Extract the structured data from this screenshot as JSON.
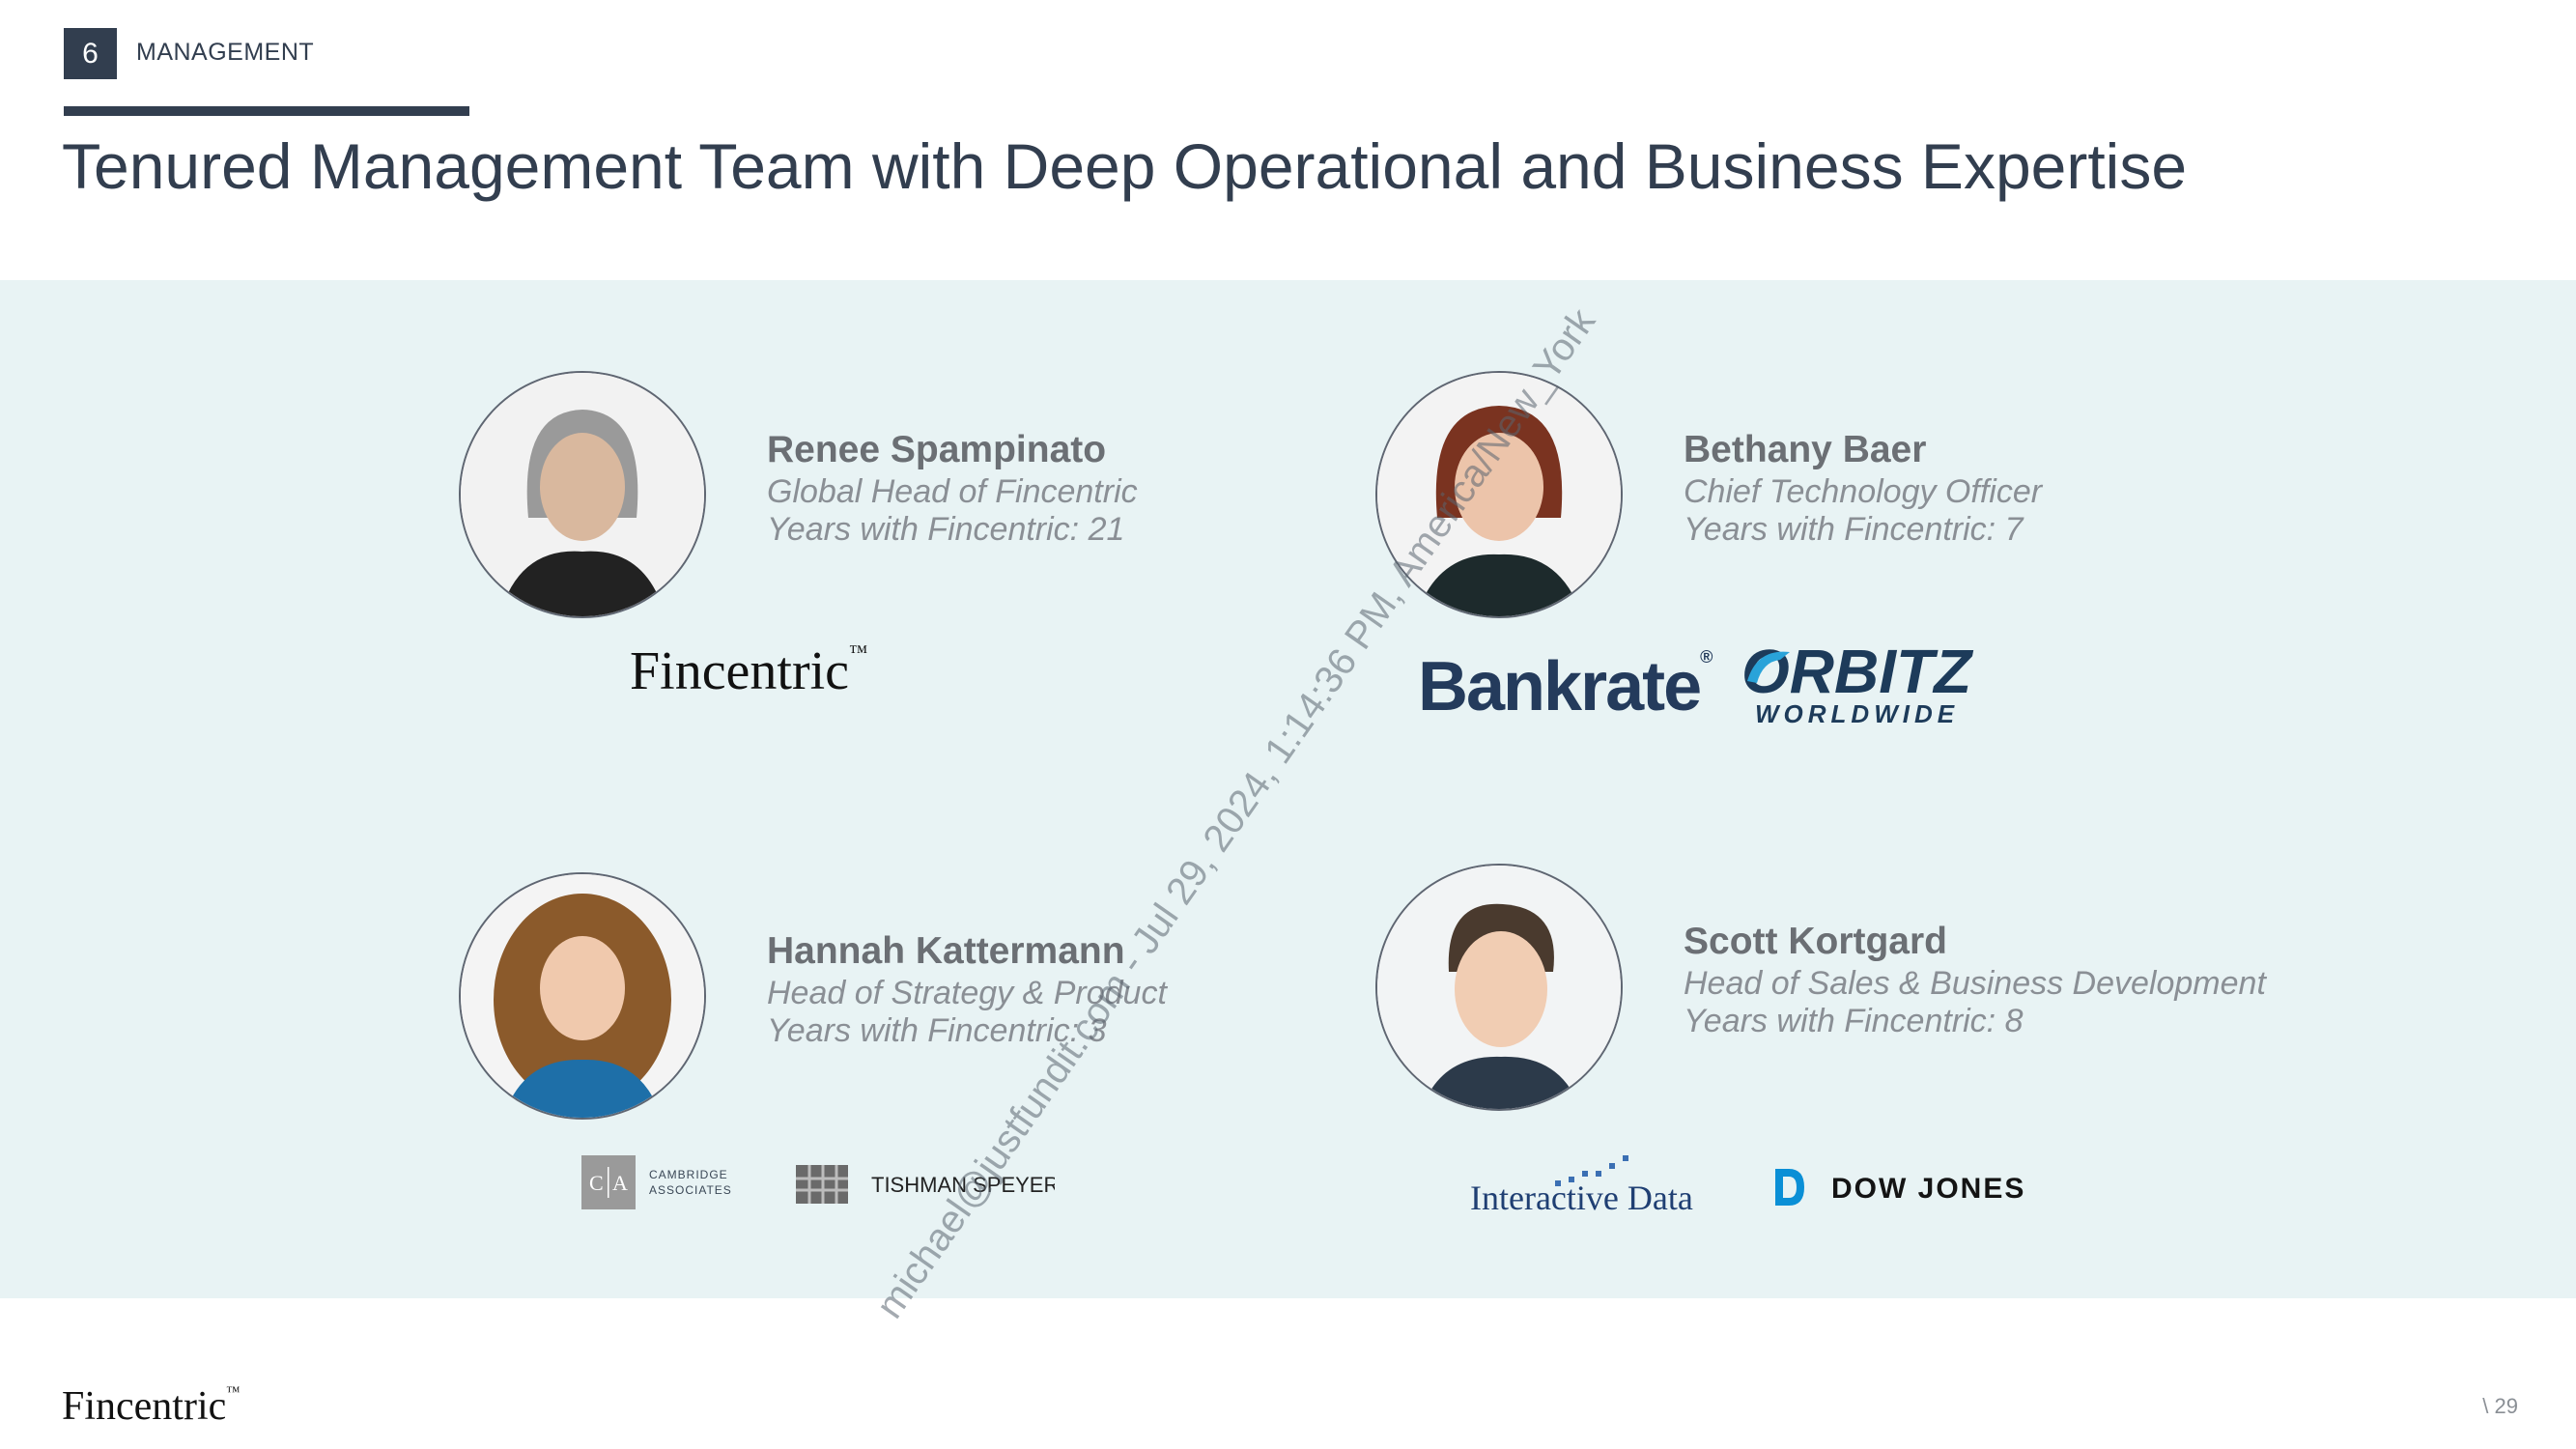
{
  "header": {
    "section_number": "6",
    "section_label": "MANAGEMENT",
    "title": "Tenured Management Team with Deep Operational and Business Expertise"
  },
  "team": [
    {
      "name": "Renee Spampinato",
      "role": "Global Head of Fincentric",
      "tenure": "Years with Fincentric: 21",
      "logos": [
        "Fincentric"
      ]
    },
    {
      "name": "Bethany Baer",
      "role": "Chief Technology Officer",
      "tenure": "Years with Fincentric: 7",
      "logos": [
        "Bankrate",
        "ORBITZ WORLDWIDE"
      ]
    },
    {
      "name": "Hannah Kattermann",
      "role": "Head of Strategy & Product",
      "tenure": "Years with Fincentric: 3",
      "logos": [
        "CAMBRIDGE ASSOCIATES",
        "TISHMAN SPEYER"
      ]
    },
    {
      "name": "Scott Kortgard",
      "role": "Head of Sales & Business Development",
      "tenure": "Years with Fincentric: 8",
      "logos": [
        "Interactive Data",
        "DOW JONES"
      ]
    }
  ],
  "watermark": "michael@justfundit.com - Jul 29, 2024, 1:14:36 PM, America/New_York",
  "footer": {
    "brand": "Fincentric",
    "page_number": "\\ 29"
  },
  "colors": {
    "navy": "#323e4f",
    "band": "#e8f3f4",
    "name_gray": "#6b6f74",
    "detail_gray": "#8a8f95"
  }
}
